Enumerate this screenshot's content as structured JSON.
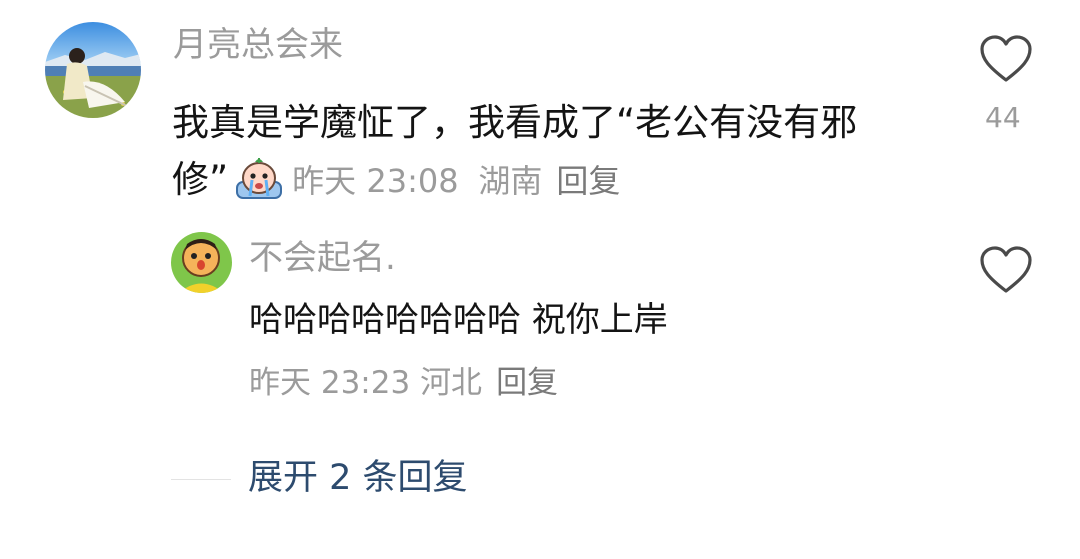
{
  "comments": [
    {
      "username": "月亮总会来",
      "text": "我真是学魔怔了，我看成了“老公有没有邪修”",
      "time": "昨天 23:08",
      "location": "湖南",
      "reply_label": "回复",
      "likes": "44",
      "sticker_icon": "crying-sticker-icon"
    },
    {
      "username": "不会起名.",
      "text": "哈哈哈哈哈哈哈哈 祝你上岸",
      "time": "昨天 23:23",
      "location": "河北",
      "reply_label": "回复"
    }
  ],
  "expand_replies": "展开 2 条回复",
  "colors": {
    "username": "#9b9b9b",
    "text": "#141414",
    "link": "#2d4b6e"
  }
}
